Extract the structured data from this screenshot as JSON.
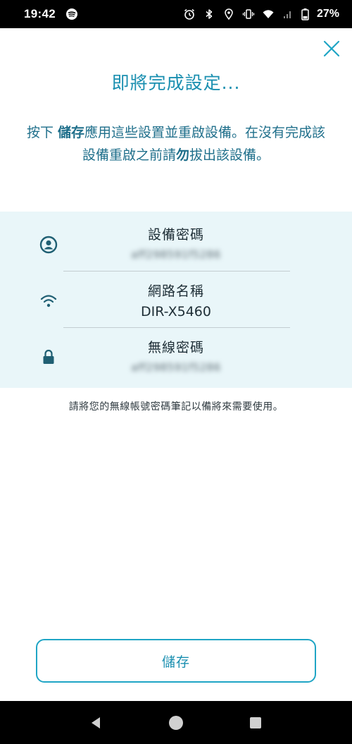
{
  "status_bar": {
    "time": "19:42",
    "battery": "27%",
    "icons": [
      "spotify-icon",
      "alarm-icon",
      "bluetooth-icon",
      "location-icon",
      "vibrate-icon",
      "wifi-icon",
      "signal-icon",
      "battery-icon"
    ]
  },
  "page": {
    "title": "即將完成設定...",
    "instructions_part1": "按下 ",
    "instructions_bold1": "儲存",
    "instructions_part2": "應用這些設置並重啟設備。在沒有完成該設備重啟之前請",
    "instructions_bold2": "勿",
    "instructions_part3": "拔出該設備。"
  },
  "info": {
    "device_password": {
      "label": "設備密碼",
      "value": "aff298591f5286",
      "icon": "user-icon"
    },
    "network_name": {
      "label": "網路名稱",
      "value": "DIR-X5460",
      "icon": "wifi-icon"
    },
    "wireless_password": {
      "label": "無線密碼",
      "value": "aff298591f5286",
      "icon": "lock-icon"
    }
  },
  "note": "請將您的無線帳號密碼筆記以備將來需要使用。",
  "save_button_label": "儲存",
  "colors": {
    "accent": "#1a8fb0",
    "panel": "#e9f6f9",
    "text": "#1e2e36"
  }
}
